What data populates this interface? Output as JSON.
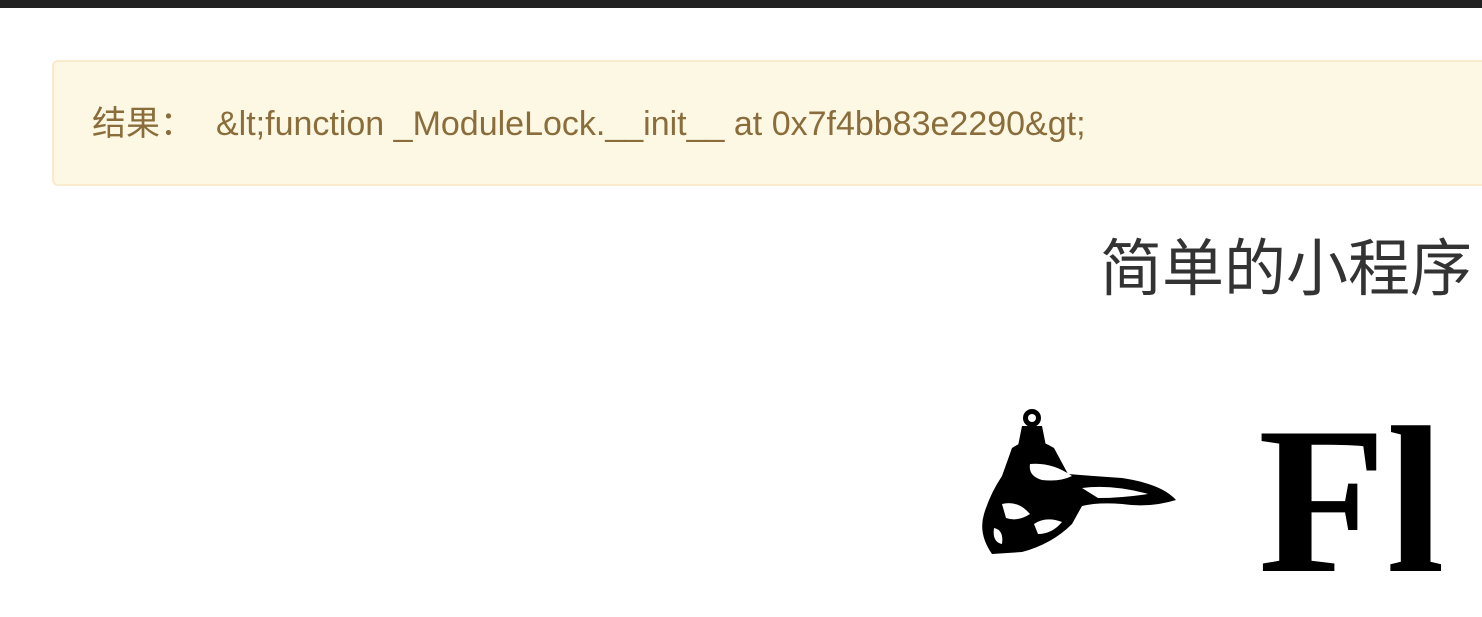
{
  "result": {
    "label": "结果：",
    "value": "&lt;function _ModuleLock.__init__ at 0x7f4bb83e2290&gt;"
  },
  "heading": {
    "text": "简单的小程序 -"
  },
  "logo": {
    "icon": "flask-icon",
    "text": "Fl"
  },
  "colors": {
    "alert_bg": "#fcf8e3",
    "alert_border": "#faebcc",
    "alert_text": "#8a6d3b",
    "topbar": "#222222"
  }
}
